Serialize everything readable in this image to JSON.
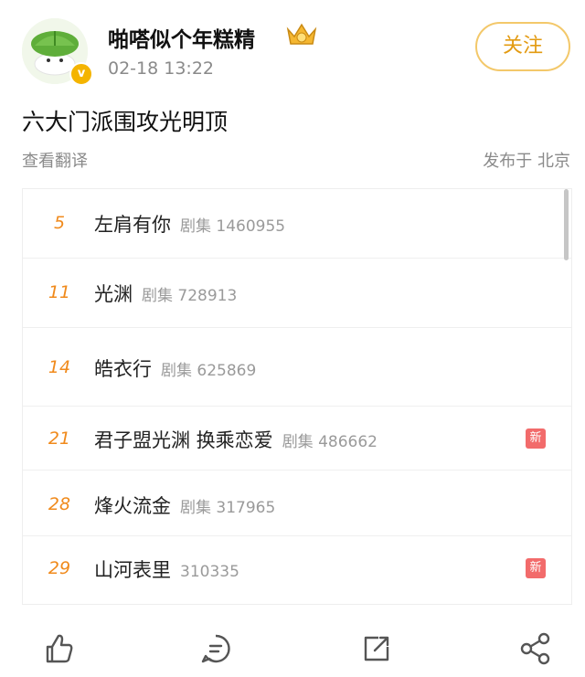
{
  "post": {
    "username": "啪嗒似个年糕精",
    "timestamp": "02-18 13:22",
    "follow_label": "关注",
    "text": "六大门派围攻光明顶",
    "translate_label": "查看翻译",
    "location": "发布于 北京"
  },
  "rankings": [
    {
      "rank": "5",
      "title": "左肩有你",
      "meta": "剧集 1460955",
      "is_new": false
    },
    {
      "rank": "11",
      "title": "光渊",
      "meta": "剧集 728913",
      "is_new": false
    },
    {
      "rank": "14",
      "title": "皓衣行",
      "meta": "剧集 625869",
      "is_new": false
    },
    {
      "rank": "21",
      "title": "君子盟光渊 换乘恋爱",
      "meta": "剧集 486662",
      "is_new": true
    },
    {
      "rank": "28",
      "title": "烽火流金",
      "meta": "剧集 317965",
      "is_new": false
    },
    {
      "rank": "29",
      "title": "山河表里",
      "meta": "310335",
      "is_new": true
    }
  ],
  "new_badge_label": "新",
  "actions": {
    "icons": [
      "like-icon",
      "comment-icon",
      "repost-icon",
      "share-icon"
    ]
  },
  "colors": {
    "accent_orange": "#f08a1c",
    "follow_border": "#f3c86a",
    "follow_text": "#e39b12",
    "new_badge": "#f26b6b",
    "muted_text": "#8a8a8a"
  }
}
